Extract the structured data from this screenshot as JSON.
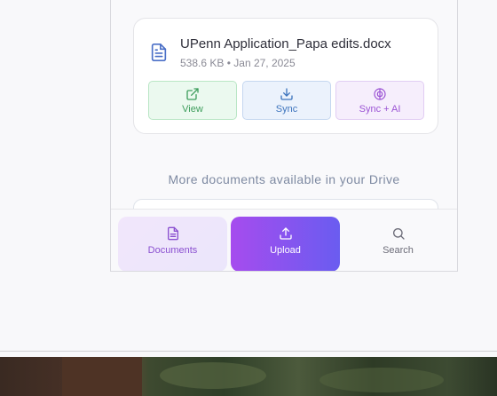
{
  "file": {
    "name": "UPenn Application_Papa edits.docx",
    "size": "538.6 KB",
    "separator": "•",
    "date": "Jan 27, 2025",
    "icon": "document-icon"
  },
  "actions": [
    {
      "label": "View",
      "icon": "external-link-icon",
      "color": "#3f9e5d"
    },
    {
      "label": "Sync",
      "icon": "download-icon",
      "color": "#3d74bd"
    },
    {
      "label": "Sync + AI",
      "icon": "brain-icon",
      "color": "#9b53d4"
    }
  ],
  "more_text": "More documents available in your Drive",
  "nav": [
    {
      "label": "Documents",
      "icon": "document-icon",
      "active": true
    },
    {
      "label": "Upload",
      "icon": "upload-icon",
      "accent": "#a64cee"
    },
    {
      "label": "Search",
      "icon": "search-icon"
    }
  ]
}
